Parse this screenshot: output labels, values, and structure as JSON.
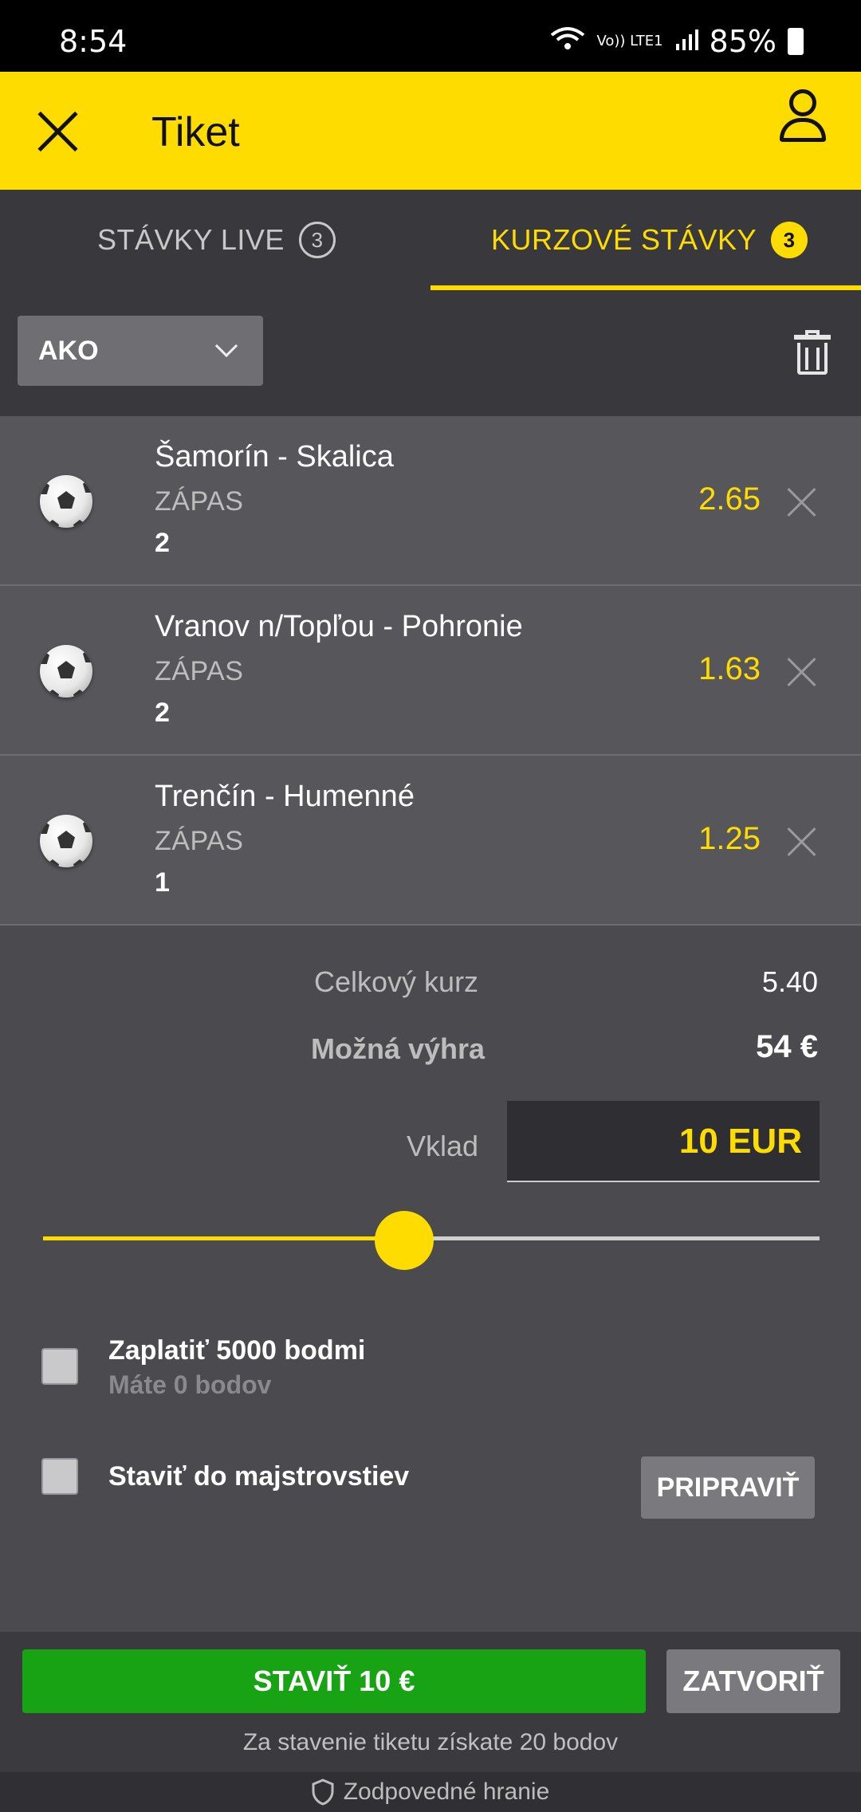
{
  "status_bar": {
    "time": "8:54",
    "network": "Vo)) LTE1",
    "battery": "85%"
  },
  "header": {
    "title": "Tiket"
  },
  "tabs": [
    {
      "label": "STÁVKY LIVE",
      "count": "3",
      "active": false
    },
    {
      "label": "KURZOVÉ STÁVKY",
      "count": "3",
      "active": true
    }
  ],
  "toolbar": {
    "bet_type": "AKO"
  },
  "bets": [
    {
      "match": "Šamorín - Skalica",
      "market": "ZÁPAS",
      "selection": "2",
      "odds": "2.65",
      "sport_icon": "soccer-ball-icon"
    },
    {
      "match": "Vranov n/Topľou - Pohronie",
      "market": "ZÁPAS",
      "selection": "2",
      "odds": "1.63",
      "sport_icon": "soccer-ball-icon"
    },
    {
      "match": "Trenčín - Humenné",
      "market": "ZÁPAS",
      "selection": "1",
      "odds": "1.25",
      "sport_icon": "soccer-ball-icon"
    }
  ],
  "summary": {
    "total_odds_label": "Celkový kurz",
    "total_odds_value": "5.40",
    "possible_win_label": "Možná výhra",
    "possible_win_value": "54 €",
    "stake_label": "Vklad",
    "stake_value": "10 EUR",
    "stake_slider_level": 0.465
  },
  "options": {
    "pay_points_label": "Zaplatiť 5000 bodmi",
    "pay_points_sub": "Máte 0 bodov",
    "tournament_label": "Staviť do majstrovstiev",
    "prepare_button": "PRIPRAVIŤ"
  },
  "footer": {
    "place_bet_button": "STAVIŤ 10 €",
    "close_button": "ZATVORIŤ",
    "points_note": "Za stavenie tiketu získate 20 bodov",
    "responsible_gaming": "Zodpovedné hranie"
  },
  "colors": {
    "accent": "#ffdc00",
    "place_bet": "#17a313",
    "panel": "#56565b"
  }
}
